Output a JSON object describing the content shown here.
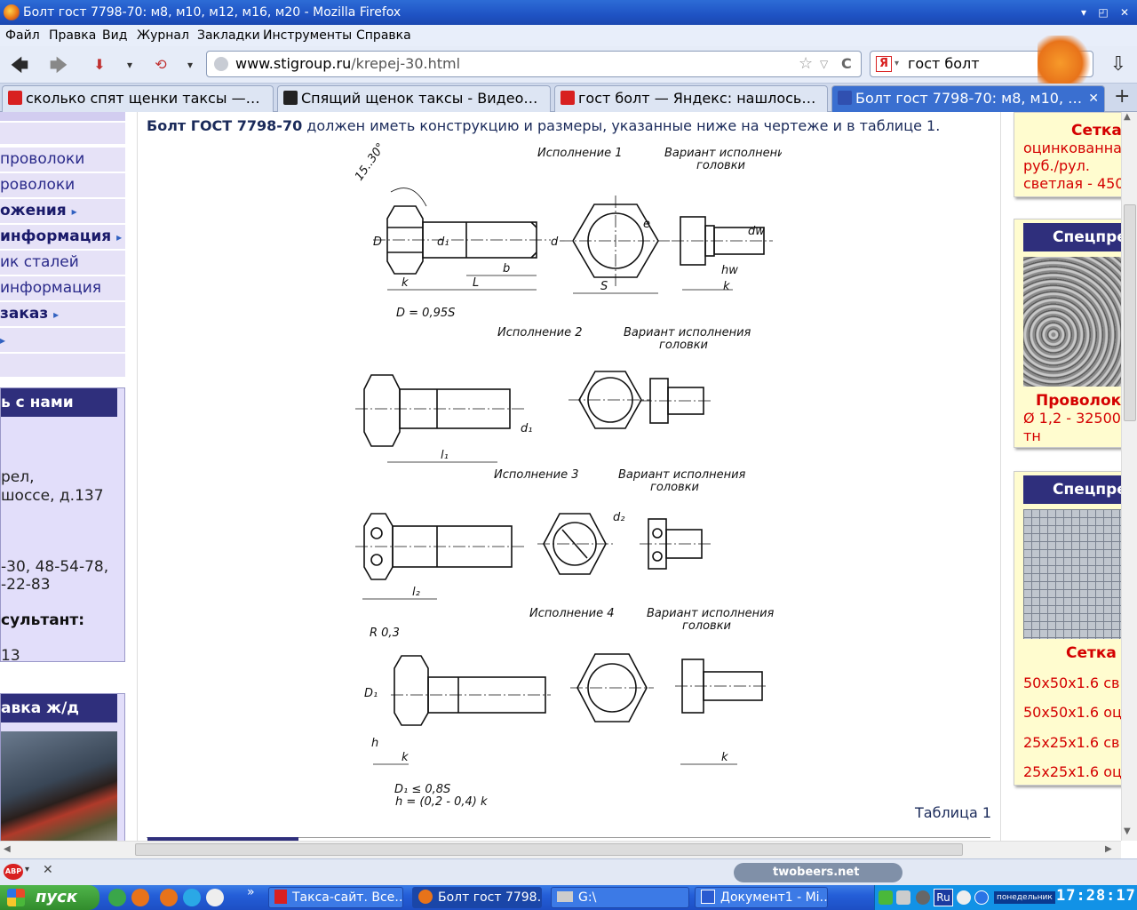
{
  "window": {
    "title": "Болт гост 7798-70: м8, м10, м12, м16, м20 - Mozilla Firefox",
    "min": "▾",
    "restore": "◰",
    "close": "✕"
  },
  "menu": [
    "Файл",
    "Правка",
    "Вид",
    "Журнал",
    "Закладки",
    "Инструменты",
    "Справка"
  ],
  "address": {
    "domain": "www.stigroup.ru",
    "path": "/krepej-30.html",
    "star": "☆",
    "reload": "C"
  },
  "search": {
    "value": "гост болт",
    "engine": "Я"
  },
  "tabs": [
    {
      "label": "сколько спят щенки таксы —…",
      "icon": "yandex-icon",
      "color": "#d82020"
    },
    {
      "label": "Спящий щенок таксы - Видео…",
      "icon": "play-icon",
      "color": "#222222"
    },
    {
      "label": "гост болт — Яндекс: нашлось…",
      "icon": "yandex-icon",
      "color": "#d82020"
    },
    {
      "label": "Болт гост 7798-70: м8, м10, …",
      "icon": "site-icon",
      "color": "#3050b0"
    }
  ],
  "tab_close": "✕",
  "tab_new": "+",
  "left_nav": [
    {
      "label": "проволоки",
      "bold": false
    },
    {
      "label": "роволоки",
      "bold": false
    },
    {
      "label": "ожения",
      "bold": true,
      "arrow": true
    },
    {
      "label": "информация",
      "bold": true,
      "arrow": true
    },
    {
      "label": "ик сталей",
      "bold": false
    },
    {
      "label": " информация",
      "bold": false
    },
    {
      "label": "заказ",
      "bold": true,
      "arrow": true
    },
    {
      "label": "",
      "bold": true,
      "arrow": true
    }
  ],
  "arrow_glyph": "▸",
  "contact": {
    "header": "ь с нами",
    "lines": [
      "рел,",
      "шоссе, д.137",
      "-30, 48-54-78,",
      "-22-83"
    ],
    "consult_label": "сультант:",
    "consult_num": "13"
  },
  "delivery": {
    "header": "авка ж/д"
  },
  "main": {
    "intro_bold": "Болт ГОСТ 7798-70",
    "intro_rest": " должен иметь конструкцию и размеры, указанные ниже на чертеже и в таблице 1.",
    "table_caption": "Таблица 1"
  },
  "drawing": {
    "v1": "Исполнение 1",
    "v2": "Исполнение 2",
    "v3": "Исполнение 3",
    "v4": "Исполнение 4",
    "head_var": "Вариант исполнения",
    "head_var2": "головки",
    "angle": "15..30°",
    "eq1": "D = 0,95S",
    "r": "R 0,3",
    "eq2": "D₁ ≤ 0,8S",
    "eq3": "h = (0,2 - 0,4) k",
    "D": "D",
    "d1": "d₁",
    "d": "d",
    "e": "e",
    "dw": "dw",
    "b": "b",
    "L": "L",
    "k": "k",
    "S": "S",
    "hw": "hw",
    "l1": "l₁",
    "l2": "l₂",
    "d2": "d₂",
    "D1": "D₁",
    "h": "h"
  },
  "right": {
    "box1": {
      "title": "Сетка",
      "lines": [
        "оцинкованна",
        "руб./рул.",
        "светлая - 450"
      ]
    },
    "box2": {
      "header": "Спецпре",
      "title": "Проволока",
      "lines": [
        "Ø 1,2 - 32500",
        "тн"
      ]
    },
    "box3": {
      "header": "Спецпре",
      "title": "Сетка с",
      "lines": [
        "50x50x1.6 св",
        "50x50x1.6 оц",
        "25x25x1.6 св",
        "25x25x1.6 оц"
      ]
    }
  },
  "statusbar": {
    "abp": "ABP",
    "close": "✕",
    "logo": "twobeers.net"
  },
  "taskbar": {
    "start": "пуск",
    "chevron": "»",
    "items": [
      "Такса-сайт. Все…",
      "Болт гост 7798…",
      "G:\\",
      "Документ1 - Mi…"
    ],
    "lang": "Ru",
    "day": "понедельник",
    "time": "17:28:17"
  }
}
